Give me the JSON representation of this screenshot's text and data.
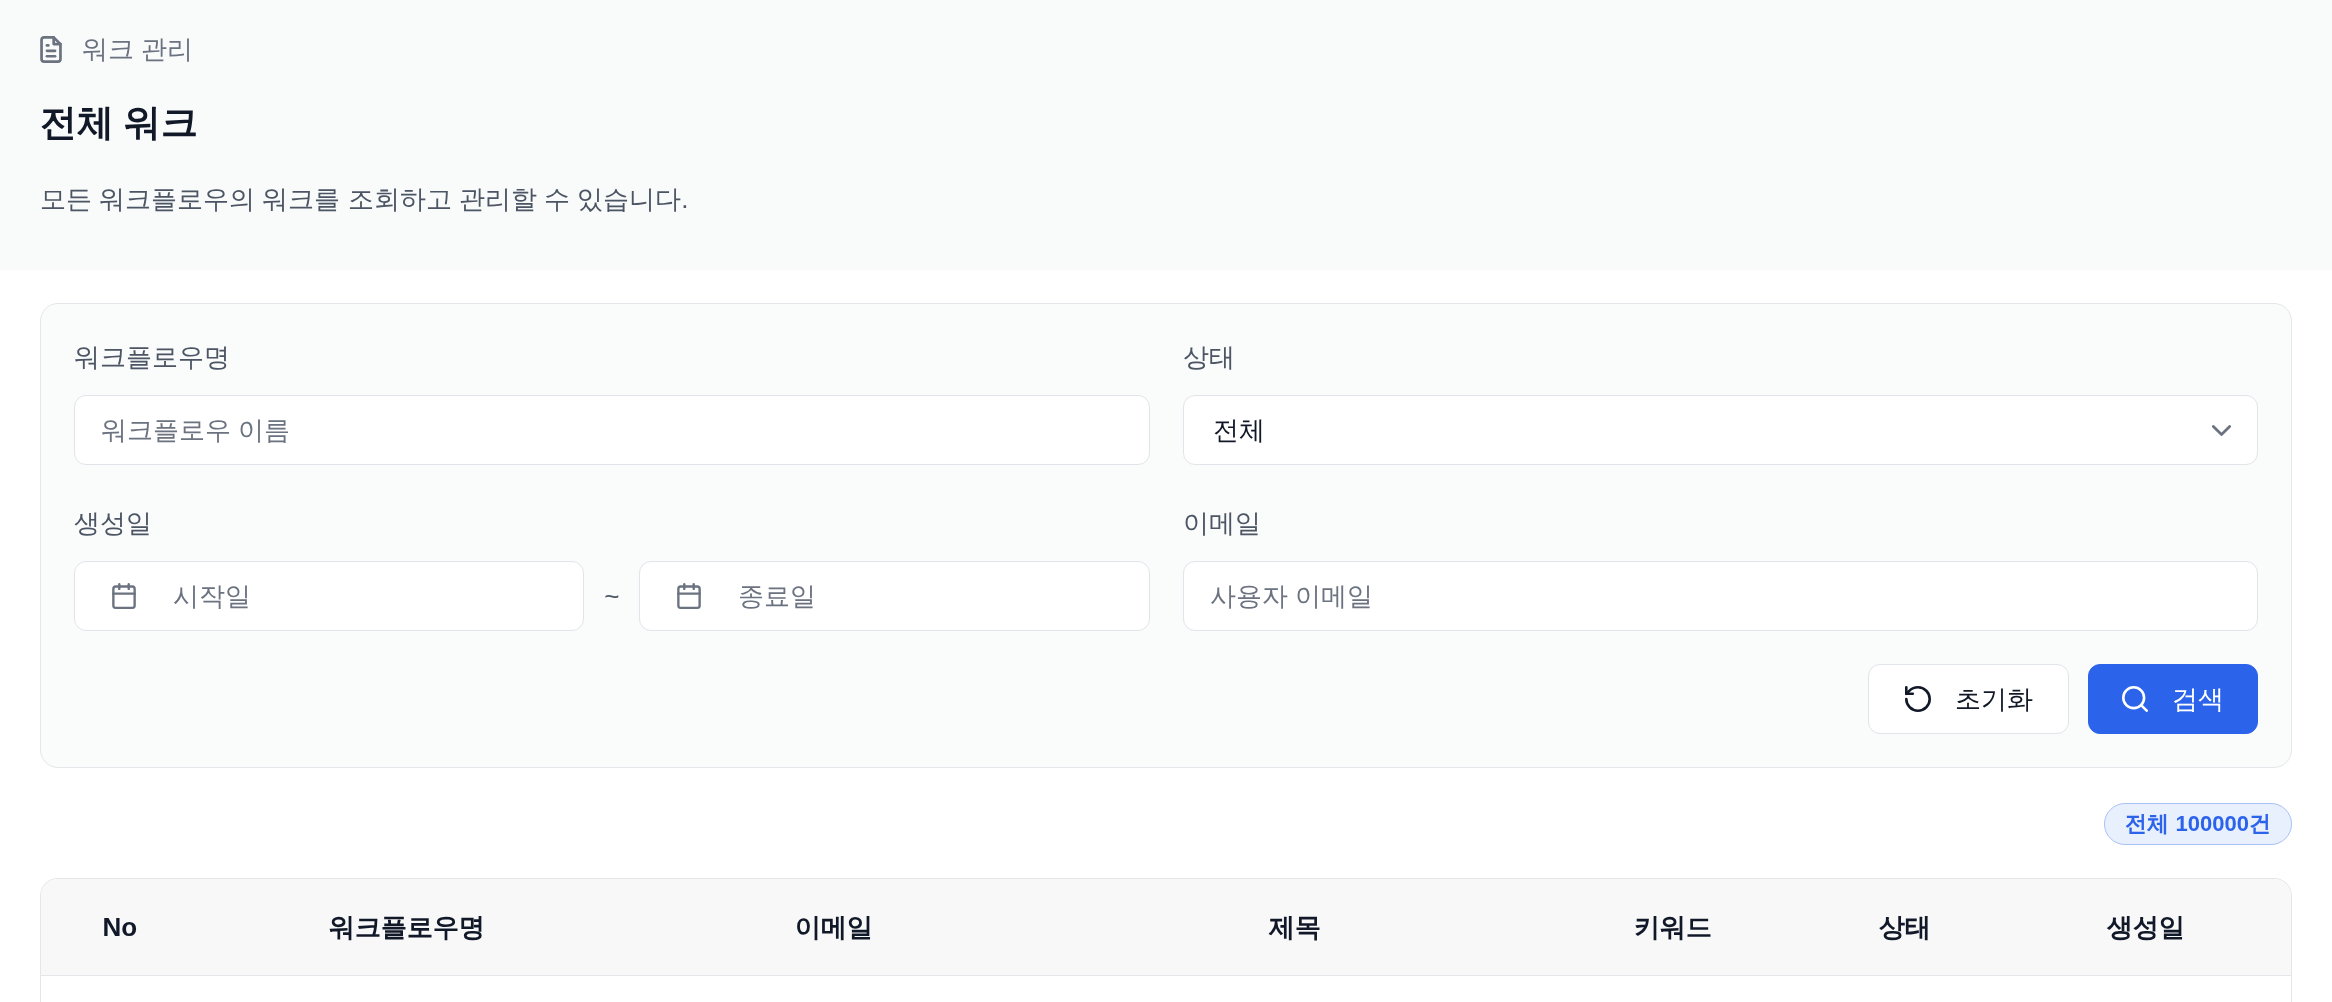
{
  "breadcrumb": {
    "label": "워크 관리"
  },
  "page": {
    "title": "전체 워크",
    "description": "모든 워크플로우의 워크를 조회하고 관리할 수 있습니다."
  },
  "filters": {
    "fields": [
      {
        "kind": "text",
        "label": "워크플로우명",
        "placeholder": "워크플로우 이름"
      },
      {
        "kind": "select",
        "label": "상태",
        "value": "전체"
      },
      {
        "kind": "date_range",
        "label": "생성일",
        "start_placeholder": "시작일",
        "separator": "~",
        "end_placeholder": "종료일"
      },
      {
        "kind": "text",
        "label": "이메일",
        "placeholder": "사용자 이메일"
      }
    ],
    "buttons": [
      {
        "kind": "reset",
        "label": "초기화"
      },
      {
        "kind": "search",
        "label": "검색"
      }
    ]
  },
  "total_badge": "전체 100000건",
  "table": {
    "columns": [
      "No",
      "워크플로우명",
      "이메일",
      "제목",
      "키워드",
      "상태",
      "생성일"
    ]
  }
}
